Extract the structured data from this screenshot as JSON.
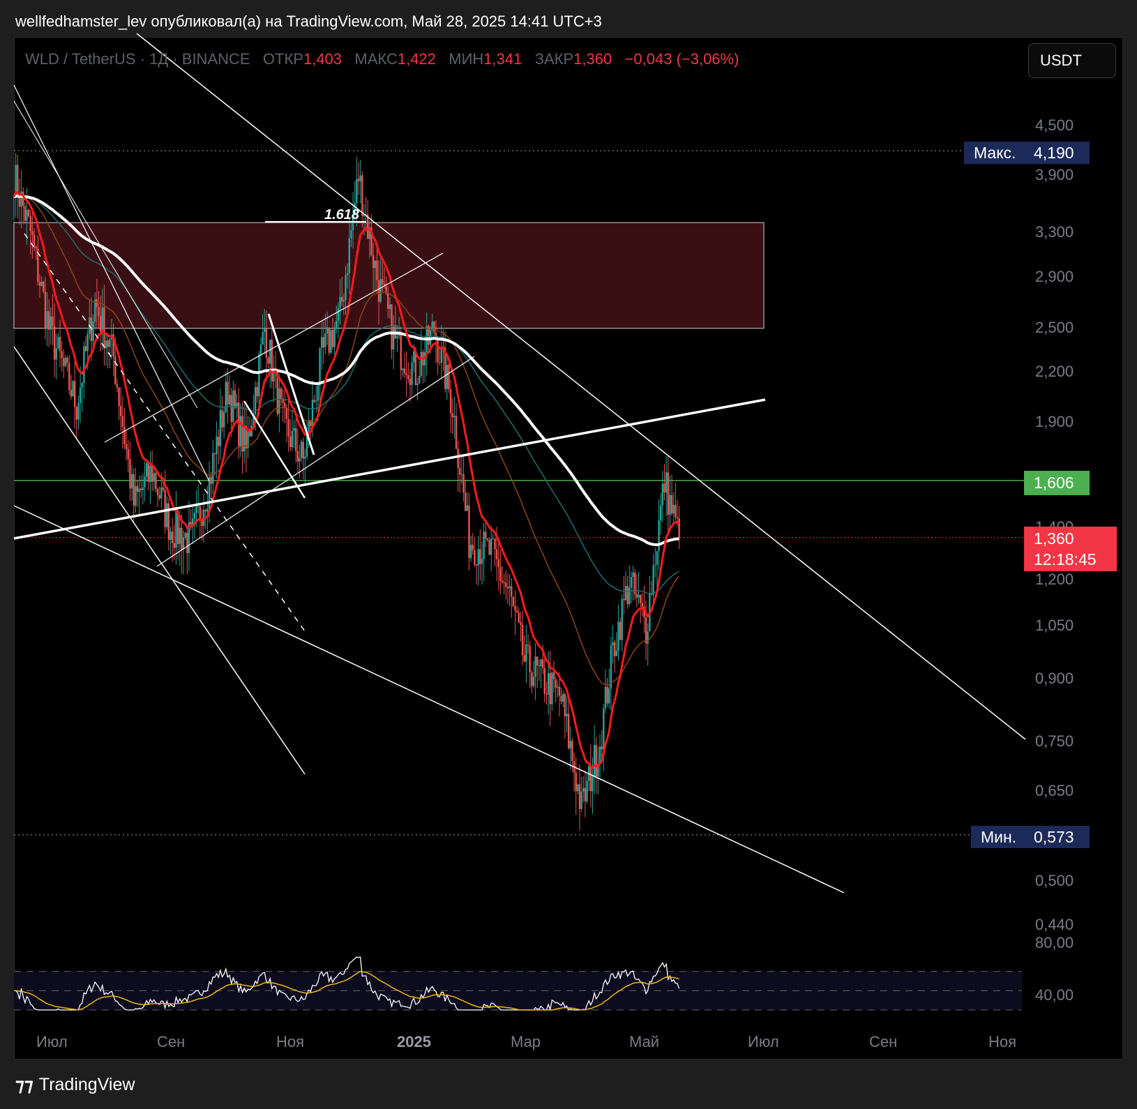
{
  "header": {
    "publisher_line": "wellfedhamster_lev опубликовал(а) на TradingView.com, Май 28, 2025 14:41 UTC+3"
  },
  "legend": {
    "symbol": "WLD / TetherUS · 1Д · BINANCE",
    "open_label": "ОТКР",
    "open": "1,403",
    "high_label": "МАКС",
    "high": "1,422",
    "low_label": "МИН",
    "low": "1,341",
    "close_label": "ЗАКР",
    "close": "1,360",
    "change": "−0,043 (−3,06%)"
  },
  "currency_button": "USDT",
  "price_axis": {
    "ticks": [
      "4,500",
      "3,900",
      "3,300",
      "2,900",
      "2,500",
      "2,200",
      "1,900",
      "1,400",
      "1,200",
      "1,050",
      "0,900",
      "0,750",
      "0,650",
      "0,500",
      "0,440"
    ],
    "max_label": "Макс.",
    "max_value": "4,190",
    "min_label": "Мин.",
    "min_value": "0,573",
    "level_value": "1,606",
    "last_price": "1,360",
    "countdown": "12:18:45"
  },
  "rsi_axis": {
    "ticks": [
      "80,00",
      "40,00"
    ]
  },
  "time_axis": {
    "labels": [
      "Июл",
      "Сен",
      "Ноя",
      "2025",
      "Мар",
      "Май",
      "Июл",
      "Сен",
      "Ноя"
    ]
  },
  "annotation": {
    "fib_label": "1.618"
  },
  "colors": {
    "up": "#26a69a",
    "down": "#ef5350",
    "ema_fast": "#ff1a1a",
    "ema_mid": "#8b4513",
    "ema_teal": "#1e6e6e",
    "sma_white": "#ffffff",
    "level_green": "#4caf50",
    "last_red": "#f23645",
    "zone_fill": "#3a0f14",
    "rsi": "#ffffff",
    "rsi_ma": "#f0b90b"
  },
  "footer": {
    "brand": "TradingView"
  },
  "chart_data": {
    "type": "candlestick",
    "symbol": "WLD/USDT",
    "interval": "1D",
    "y_scale": "log",
    "ylim": [
      0.44,
      4.5
    ],
    "x_range": [
      "2024-06-01",
      "2025-11-30"
    ],
    "ohlc_last": {
      "open": 1.403,
      "high": 1.422,
      "low": 1.341,
      "close": 1.36
    },
    "price_path": [
      [
        "2024-06-01",
        3.9
      ],
      [
        "2024-06-10",
        3.3
      ],
      [
        "2024-06-20",
        2.5
      ],
      [
        "2024-07-05",
        2.0
      ],
      [
        "2024-07-15",
        2.7
      ],
      [
        "2024-07-25",
        2.3
      ],
      [
        "2024-08-05",
        1.5
      ],
      [
        "2024-08-15",
        1.65
      ],
      [
        "2024-08-25",
        1.4
      ],
      [
        "2024-09-05",
        1.35
      ],
      [
        "2024-09-15",
        1.6
      ],
      [
        "2024-09-25",
        2.1
      ],
      [
        "2024-10-05",
        1.75
      ],
      [
        "2024-10-15",
        2.5
      ],
      [
        "2024-10-25",
        1.9
      ],
      [
        "2024-11-05",
        1.7
      ],
      [
        "2024-11-15",
        2.3
      ],
      [
        "2024-11-25",
        2.6
      ],
      [
        "2024-12-05",
        3.9
      ],
      [
        "2024-12-15",
        2.9
      ],
      [
        "2024-12-25",
        2.4
      ],
      [
        "2025-01-05",
        2.2
      ],
      [
        "2025-01-15",
        2.5
      ],
      [
        "2025-01-25",
        2.0
      ],
      [
        "2025-02-03",
        1.35
      ],
      [
        "2025-02-15",
        1.3
      ],
      [
        "2025-02-25",
        1.15
      ],
      [
        "2025-03-05",
        0.95
      ],
      [
        "2025-03-15",
        0.9
      ],
      [
        "2025-03-25",
        0.85
      ],
      [
        "2025-04-05",
        0.62
      ],
      [
        "2025-04-15",
        0.75
      ],
      [
        "2025-04-22",
        0.98
      ],
      [
        "2025-05-01",
        1.2
      ],
      [
        "2025-05-10",
        1.05
      ],
      [
        "2025-05-20",
        1.6
      ],
      [
        "2025-05-28",
        1.36
      ]
    ],
    "max": 4.19,
    "min": 0.573,
    "horizontal_level": 1.606,
    "resistance_zone": [
      2.5,
      3.4
    ],
    "rsi": {
      "ylim": [
        30,
        85
      ],
      "levels": [
        70,
        50,
        30
      ]
    }
  }
}
